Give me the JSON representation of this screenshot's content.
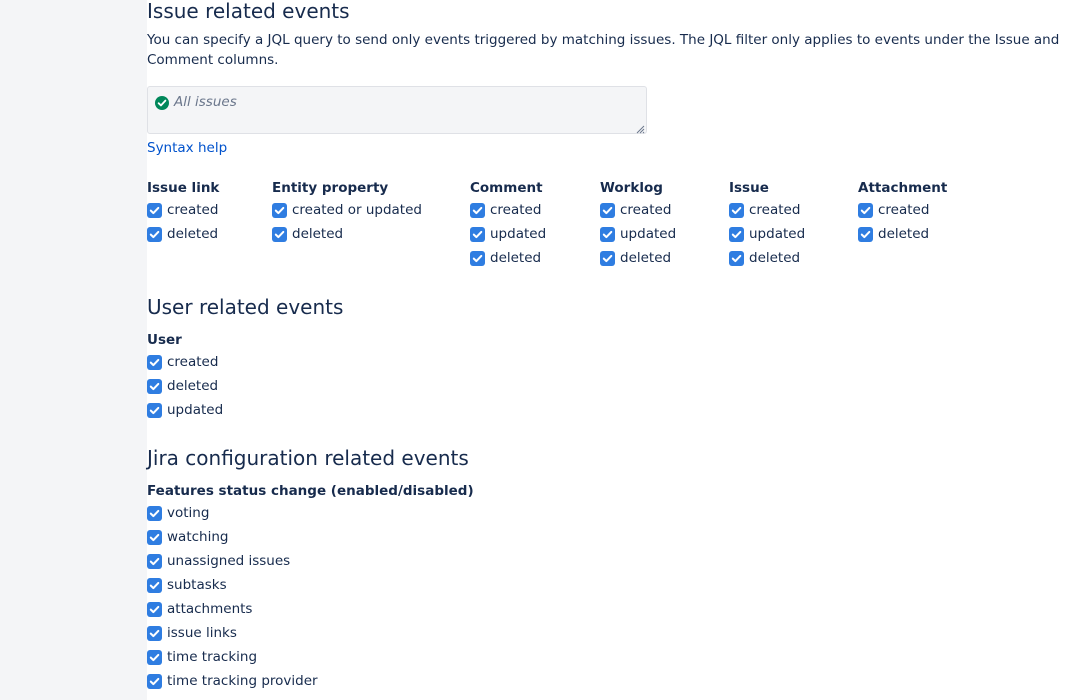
{
  "issue_section": {
    "title": "Issue related events",
    "description": "You can specify a JQL query to send only events triggered by matching issues. The JQL filter only applies to events under the Issue and Comment columns.",
    "jql_value": "All issues",
    "syntax_help": "Syntax help",
    "columns": [
      {
        "title": "Issue link",
        "items": [
          "created",
          "deleted"
        ]
      },
      {
        "title": "Entity property",
        "items": [
          "created or updated",
          "deleted"
        ]
      },
      {
        "title": "Comment",
        "items": [
          "created",
          "updated",
          "deleted"
        ]
      },
      {
        "title": "Worklog",
        "items": [
          "created",
          "updated",
          "deleted"
        ]
      },
      {
        "title": "Issue",
        "items": [
          "created",
          "updated",
          "deleted"
        ]
      },
      {
        "title": "Attachment",
        "items": [
          "created",
          "deleted"
        ]
      }
    ]
  },
  "user_section": {
    "title": "User related events",
    "group_title": "User",
    "items": [
      "created",
      "deleted",
      "updated"
    ]
  },
  "config_section": {
    "title": "Jira configuration related events",
    "group_title": "Features status change (enabled/disabled)",
    "items": [
      "voting",
      "watching",
      "unassigned issues",
      "subtasks",
      "attachments",
      "issue links",
      "time tracking",
      "time tracking provider"
    ]
  },
  "colors": {
    "checkbox": "#2f7de1",
    "link": "#0052cc",
    "success": "#00875a",
    "sidebar": "#f4f5f7"
  }
}
